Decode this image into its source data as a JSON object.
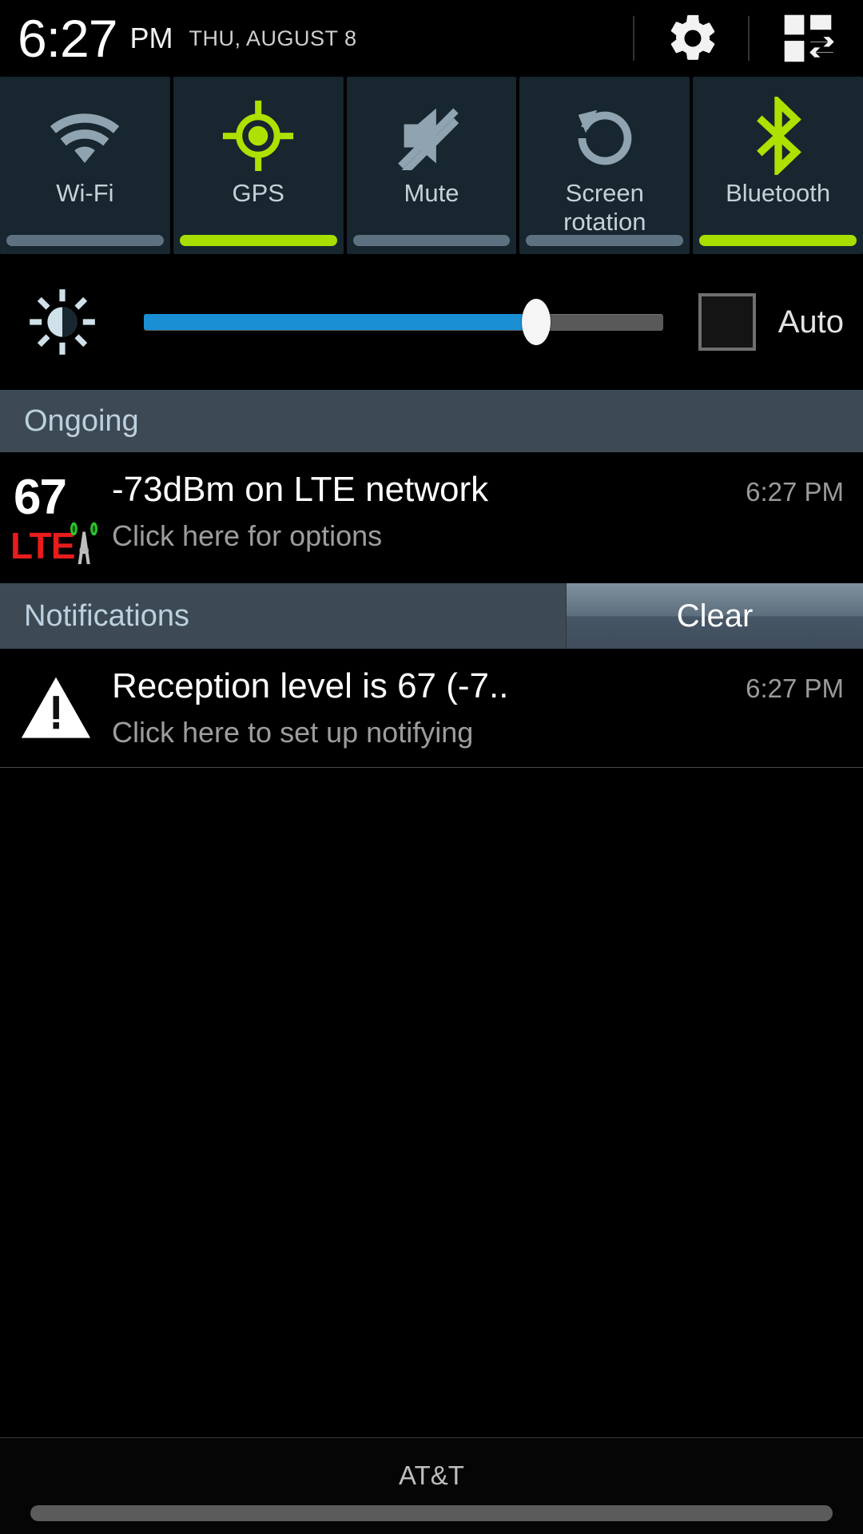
{
  "statusbar": {
    "time": "6:27",
    "ampm": "PM",
    "date": "THU, AUGUST 8",
    "gear_icon": "gear-icon",
    "panel_toggle_icon": "panel-switch-icon"
  },
  "quick_settings": {
    "tiles": [
      {
        "label": "Wi-Fi",
        "icon": "wifi-icon",
        "state": "off"
      },
      {
        "label": "GPS",
        "icon": "gps-crosshair-icon",
        "state": "on"
      },
      {
        "label": "Mute",
        "icon": "speaker-mute-icon",
        "state": "off"
      },
      {
        "label": "Screen rotation",
        "icon": "rotate-icon",
        "state": "off"
      },
      {
        "label": "Bluetooth",
        "icon": "bluetooth-icon",
        "state": "on"
      }
    ],
    "on_color": "#a8dd00",
    "off_color": "#5d7180",
    "tile_bg": "#17262f"
  },
  "brightness": {
    "icon": "brightness-sun-icon",
    "value_percent": 75,
    "fill_color": "#1a8fd4",
    "auto_label": "Auto",
    "auto_checked": false
  },
  "ongoing": {
    "header": "Ongoing",
    "items": [
      {
        "icon": "lte-signal-icon",
        "icon_number": "67",
        "icon_network": "LTE",
        "title": "-73dBm on LTE network",
        "subtitle": "Click here for options",
        "time": "6:27 PM"
      }
    ]
  },
  "notifications": {
    "header": "Notifications",
    "clear_label": "Clear",
    "items": [
      {
        "icon": "warning-triangle-icon",
        "title": "Reception level is 67 (-7..",
        "subtitle": "Click here to set up notifying",
        "time": "6:27 PM"
      }
    ]
  },
  "bottombar": {
    "carrier": "AT&T",
    "handle": "drag-handle"
  }
}
